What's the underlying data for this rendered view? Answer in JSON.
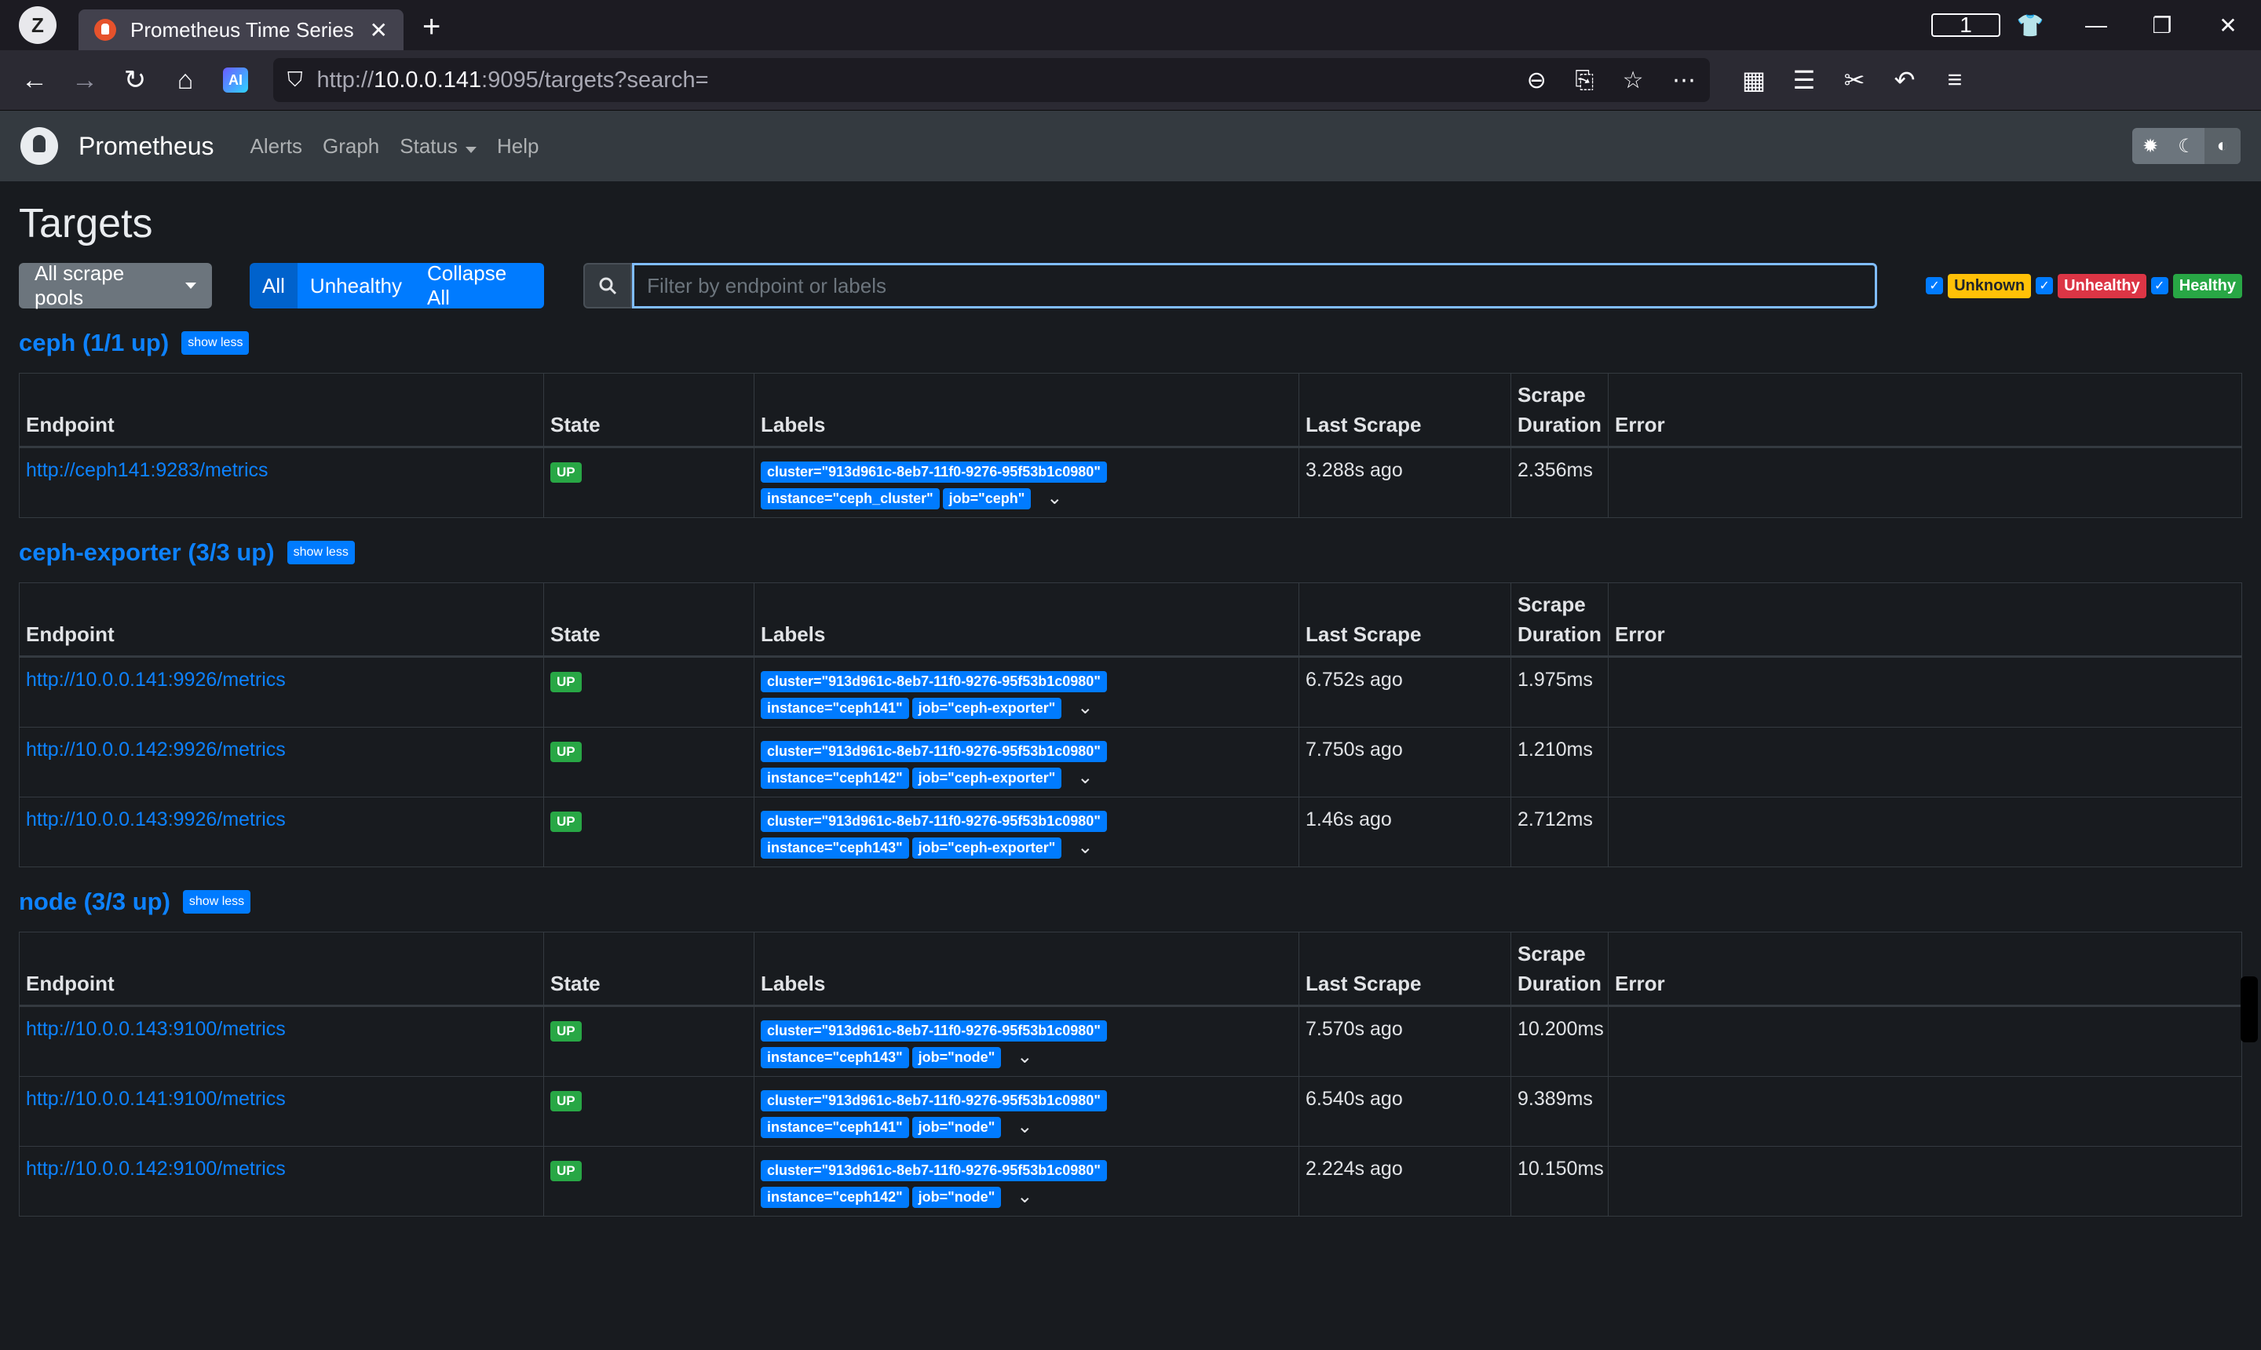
{
  "browser": {
    "profile_letter": "Z",
    "tab_title": "Prometheus Time Series Co",
    "tab_count": "1",
    "url_prefix": "http://",
    "url_host": "10.0.0.141",
    "url_rest": ":9095/targets?search=",
    "ai_label": "AI"
  },
  "app": {
    "brand": "Prometheus",
    "nav": {
      "alerts": "Alerts",
      "graph": "Graph",
      "status": "Status",
      "help": "Help"
    }
  },
  "page": {
    "title": "Targets",
    "pools_button": "All scrape pools",
    "filter_buttons": {
      "all": "All",
      "unhealthy": "Unhealthy",
      "collapse": "Collapse All"
    },
    "search_placeholder": "Filter by endpoint or labels",
    "search_value": "",
    "health_filters": {
      "unknown": "Unknown",
      "unhealthy": "Unhealthy",
      "healthy": "Healthy"
    }
  },
  "columns": {
    "endpoint": "Endpoint",
    "state": "State",
    "labels": "Labels",
    "last_scrape": "Last Scrape",
    "scrape_duration_1": "Scrape",
    "scrape_duration_2": "Duration",
    "error": "Error"
  },
  "pools": [
    {
      "title": "ceph (1/1 up)",
      "toggle": "show less",
      "rows": [
        {
          "endpoint": "http://ceph141:9283/metrics",
          "state": "UP",
          "labels": [
            "cluster=\"913d961c-8eb7-11f0-9276-95f53b1c0980\"",
            "instance=\"ceph_cluster\"",
            "job=\"ceph\""
          ],
          "last_scrape": "3.288s ago",
          "duration": "2.356ms",
          "error": ""
        }
      ]
    },
    {
      "title": "ceph-exporter (3/3 up)",
      "toggle": "show less",
      "rows": [
        {
          "endpoint": "http://10.0.0.141:9926/metrics",
          "state": "UP",
          "labels": [
            "cluster=\"913d961c-8eb7-11f0-9276-95f53b1c0980\"",
            "instance=\"ceph141\"",
            "job=\"ceph-exporter\""
          ],
          "last_scrape": "6.752s ago",
          "duration": "1.975ms",
          "error": ""
        },
        {
          "endpoint": "http://10.0.0.142:9926/metrics",
          "state": "UP",
          "labels": [
            "cluster=\"913d961c-8eb7-11f0-9276-95f53b1c0980\"",
            "instance=\"ceph142\"",
            "job=\"ceph-exporter\""
          ],
          "last_scrape": "7.750s ago",
          "duration": "1.210ms",
          "error": ""
        },
        {
          "endpoint": "http://10.0.0.143:9926/metrics",
          "state": "UP",
          "labels": [
            "cluster=\"913d961c-8eb7-11f0-9276-95f53b1c0980\"",
            "instance=\"ceph143\"",
            "job=\"ceph-exporter\""
          ],
          "last_scrape": "1.46s ago",
          "duration": "2.712ms",
          "error": ""
        }
      ]
    },
    {
      "title": "node (3/3 up)",
      "toggle": "show less",
      "rows": [
        {
          "endpoint": "http://10.0.0.143:9100/metrics",
          "state": "UP",
          "labels": [
            "cluster=\"913d961c-8eb7-11f0-9276-95f53b1c0980\"",
            "instance=\"ceph143\"",
            "job=\"node\""
          ],
          "last_scrape": "7.570s ago",
          "duration": "10.200ms",
          "error": ""
        },
        {
          "endpoint": "http://10.0.0.141:9100/metrics",
          "state": "UP",
          "labels": [
            "cluster=\"913d961c-8eb7-11f0-9276-95f53b1c0980\"",
            "instance=\"ceph141\"",
            "job=\"node\""
          ],
          "last_scrape": "6.540s ago",
          "duration": "9.389ms",
          "error": ""
        },
        {
          "endpoint": "http://10.0.0.142:9100/metrics",
          "state": "UP",
          "labels": [
            "cluster=\"913d961c-8eb7-11f0-9276-95f53b1c0980\"",
            "instance=\"ceph142\"",
            "job=\"node\""
          ],
          "last_scrape": "2.224s ago",
          "duration": "10.150ms",
          "error": ""
        }
      ]
    }
  ]
}
